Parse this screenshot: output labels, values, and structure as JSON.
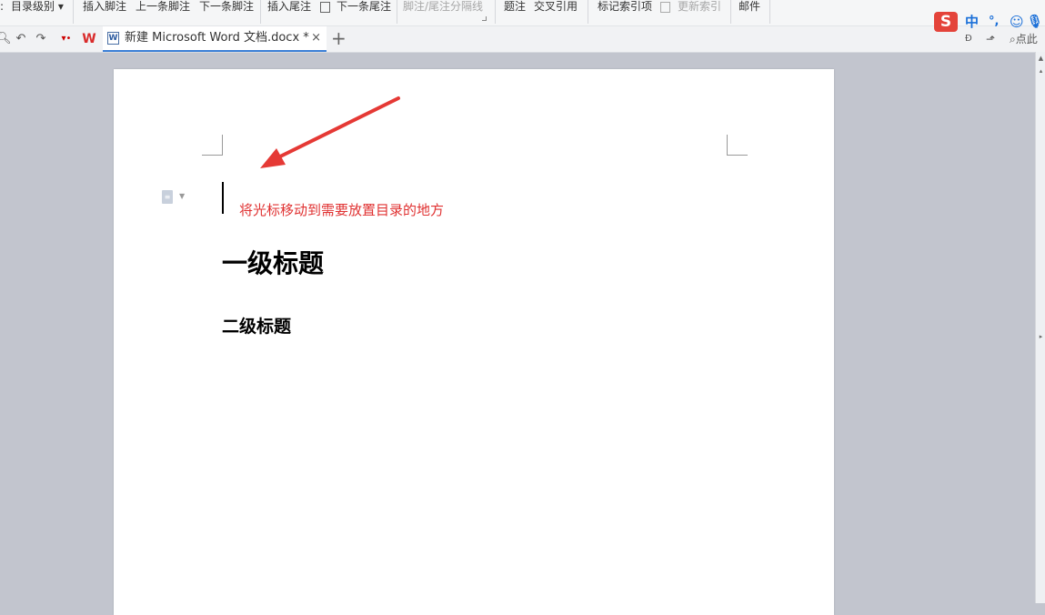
{
  "ribbon": {
    "items": [
      "目录级别",
      "插入脚注",
      "上一条脚注",
      "下一条脚注",
      "插入尾注",
      "下一条尾注",
      "脚注/尾注分隔线",
      "题注",
      "交叉引用",
      "标记索引项",
      "更新索引",
      "邮件"
    ]
  },
  "tab": {
    "title": "新建 Microsoft Word 文档.docx *",
    "close": "×",
    "add": "+"
  },
  "toolbar_right": {
    "search": "点此"
  },
  "ime": {
    "logo": "S",
    "lang": "中",
    "punct": "°,",
    "emoji": "☺",
    "mic": "🎙"
  },
  "document": {
    "hint": "将光标移动到需要放置目录的地方",
    "heading1": "一级标题",
    "heading2": "二级标题"
  },
  "colors": {
    "hint": "#e03131",
    "arrow": "#e53935",
    "tab_accent": "#3b7fd6",
    "ime_brand": "#e4433a"
  }
}
